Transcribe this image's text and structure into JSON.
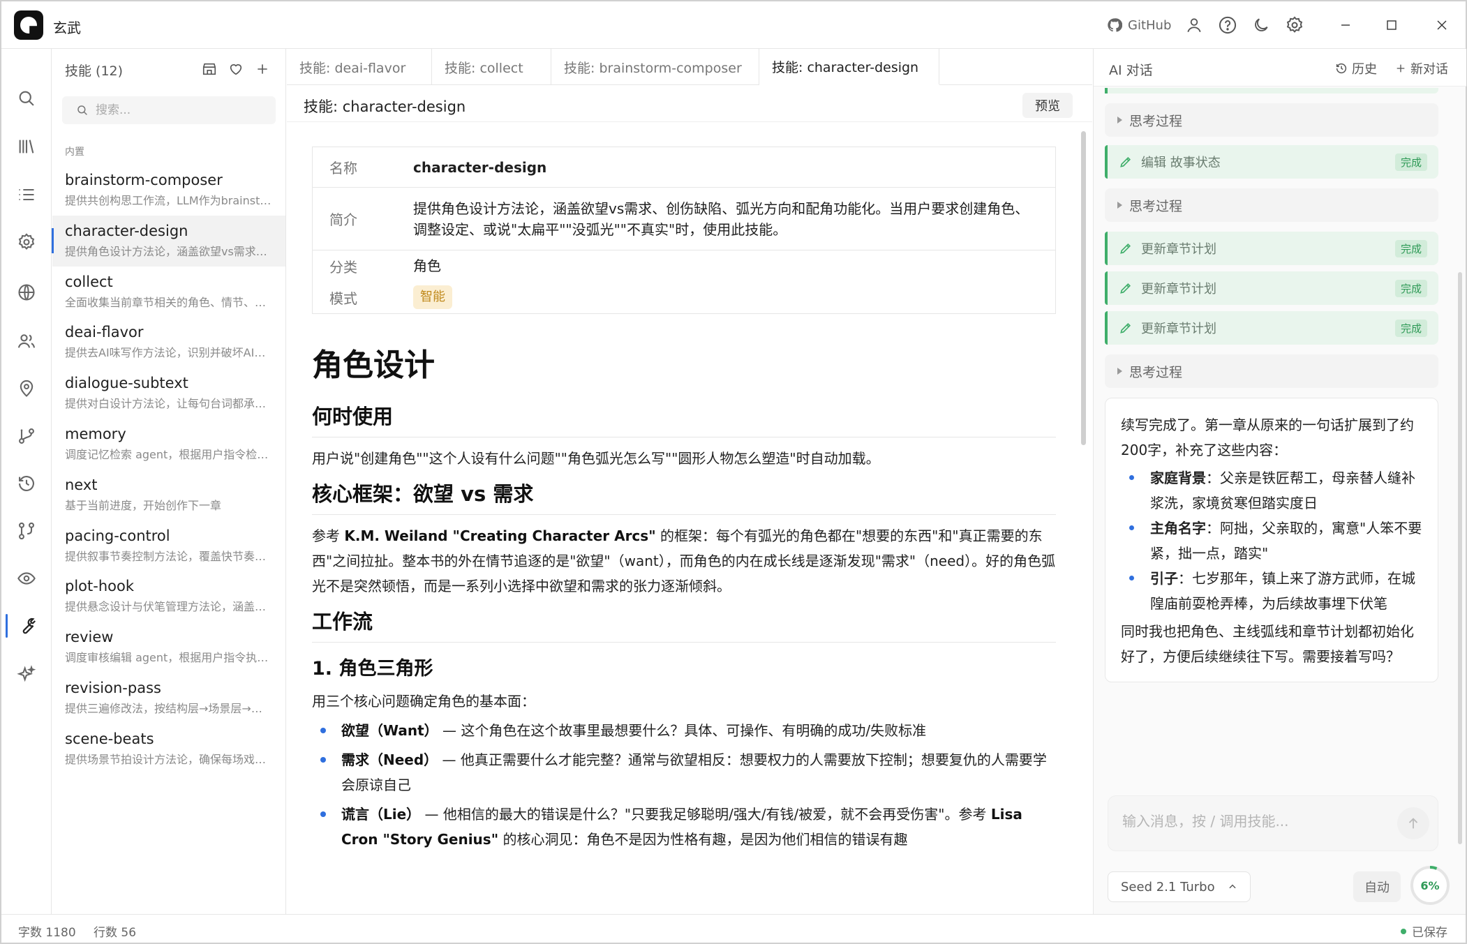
{
  "app": {
    "title": "玄武"
  },
  "titlebar": {
    "github_label": "GitHub"
  },
  "sidebar": {
    "title": "技能 (12)",
    "search_placeholder": "搜索...",
    "section_label": "内置",
    "items": [
      {
        "name": "brainstorm-composer",
        "desc": "提供共创构思工作流，LLM作为brainstorm…"
      },
      {
        "name": "character-design",
        "desc": "提供角色设计方法论，涵盖欲望vs需求…"
      },
      {
        "name": "collect",
        "desc": "全面收集当前章节相关的角色、情节、…"
      },
      {
        "name": "deai-flavor",
        "desc": "提供去AI味写作方法论，识别并破坏AI…"
      },
      {
        "name": "dialogue-subtext",
        "desc": "提供对白设计方法论，让每句台词都承…"
      },
      {
        "name": "memory",
        "desc": "调度记忆检索 agent，根据用户指令检…"
      },
      {
        "name": "next",
        "desc": "基于当前进度，开始创作下一章"
      },
      {
        "name": "pacing-control",
        "desc": "提供叙事节奏控制方法论，覆盖快节奏…"
      },
      {
        "name": "plot-hook",
        "desc": "提供悬念设计与伏笔管理方法论，涵盖…"
      },
      {
        "name": "review",
        "desc": "调度审核编辑 agent，根据用户指令执…"
      },
      {
        "name": "revision-pass",
        "desc": "提供三遍修改法，按结构层→场景层→…"
      },
      {
        "name": "scene-beats",
        "desc": "提供场景节拍设计方法论，确保每场戏…"
      }
    ]
  },
  "editor": {
    "tabs": [
      "技能: deai-flavor",
      "技能: collect",
      "技能: brainstorm-composer",
      "技能: character-design"
    ],
    "doc_title": "技能: character-design",
    "preview_label": "预览",
    "meta": {
      "name_key": "名称",
      "name_val": "character-design",
      "intro_key": "简介",
      "intro_val": "提供角色设计方法论，涵盖欲望vs需求、创伤缺陷、弧光方向和配角功能化。当用户要求创建角色、调整设定、或说\"太扁平\"\"没弧光\"\"不真实\"时，使用此技能。",
      "cat_key": "分类",
      "cat_val": "角色",
      "mode_key": "模式",
      "mode_val": "智能"
    },
    "content": {
      "h1": "角色设计",
      "h2_when": "何时使用",
      "p_when": "用户说\"创建角色\"\"这个人设有什么问题\"\"角色弧光怎么写\"\"圆形人物怎么塑造\"时自动加载。",
      "h2_core": "核心框架：欲望 vs 需求",
      "p_core_1": "参考 ",
      "p_core_ref": "K.M. Weiland \"Creating Character Arcs\"",
      "p_core_2": " 的框架：每个有弧光的角色都在\"想要的东西\"和\"真正需要的东西\"之间拉扯。整本书的外在情节追逐的是\"欲望\"（want），而角色的内在成长线是逐渐发现\"需求\"（need）。好的角色弧光不是突然顿悟，而是一系列小选择中欲望和需求的张力逐渐倾斜。",
      "h2_flow": "工作流",
      "h3_tri": "1. 角色三角形",
      "p_tri": "用三个核心问题确定角色的基本面：",
      "li_want_b": "欲望（Want）",
      "li_want": " — 这个角色在这个故事里最想要什么？具体、可操作、有明确的成功/失败标准",
      "li_need_b": "需求（Need）",
      "li_need": " — 他真正需要什么才能完整？通常与欲望相反：想要权力的人需要放下控制；想要复仇的人需要学会原谅自己",
      "li_lie_b": "谎言（Lie）",
      "li_lie_1": " — 他相信的最大的错误是什么？\"只要我足够聪明/强大/有钱/被爱，就不会再受伤害\"。参考 ",
      "li_lie_ref": "Lisa Cron \"Story Genius\"",
      "li_lie_2": " 的核心洞见：角色不是因为性格有趣，是因为他们相信的错误有趣"
    }
  },
  "ai": {
    "title": "AI 对话",
    "history_label": "历史",
    "new_label": "新对话",
    "think_label": "思考过程",
    "done_label": "完成",
    "tool_edit_state": "编辑 故事状态",
    "tool_update_plan": "更新章节计划",
    "msg_intro": "续写完成了。第一章从原来的一句话扩展到了约200字，补充了这些内容：",
    "msg_b1_b": "家庭背景",
    "msg_b1": "：父亲是铁匠帮工，母亲替人缝补浆洗，家境贫寒但踏实度日",
    "msg_b2_b": "主角名字",
    "msg_b2": "：阿拙，父亲取的，寓意\"人笨不要紧，拙一点，踏实\"",
    "msg_b3_b": "引子",
    "msg_b3": "：七岁那年，镇上来了游方武师，在城隍庙前耍枪弄棒，为后续故事埋下伏笔",
    "msg_outro": "同时我也把角色、主线弧线和章节计划都初始化好了，方便后续继续往下写。需要接着写吗？",
    "input_placeholder": "输入消息，按 / 调用技能...",
    "model": "Seed 2.1 Turbo",
    "auto_label": "自动",
    "context_usage": "6%"
  },
  "status": {
    "words": "字数 1180",
    "lines": "行数 56",
    "saved": "已保存"
  },
  "colors": {
    "accent": "#2f6fde",
    "success": "#3fae6a",
    "badge_bg": "#fbeed2",
    "badge_fg": "#c08a1d"
  }
}
